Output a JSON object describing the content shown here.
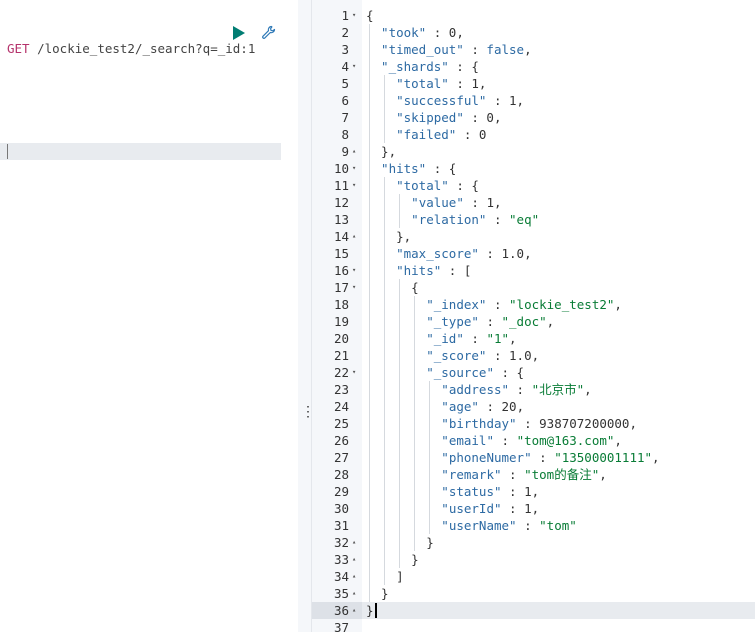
{
  "request": {
    "method": "GET",
    "path": "/lockie_test2/_search?q=_id:1",
    "run_icon": "play-icon",
    "settings_icon": "wrench-icon"
  },
  "divider": {
    "handle": "⋮"
  },
  "response": {
    "active_line": 36,
    "lines": [
      {
        "n": "1",
        "fold": "▾",
        "i": 0,
        "t": [
          [
            "p",
            "{"
          ]
        ]
      },
      {
        "n": "2",
        "fold": "",
        "i": 1,
        "t": [
          [
            "k",
            "\"took\""
          ],
          [
            "p",
            " : "
          ],
          [
            "n",
            "0"
          ],
          [
            "p",
            ","
          ]
        ]
      },
      {
        "n": "3",
        "fold": "",
        "i": 1,
        "t": [
          [
            "k",
            "\"timed_out\""
          ],
          [
            "p",
            " : "
          ],
          [
            "b",
            "false"
          ],
          [
            "p",
            ","
          ]
        ]
      },
      {
        "n": "4",
        "fold": "▾",
        "i": 1,
        "t": [
          [
            "k",
            "\"_shards\""
          ],
          [
            "p",
            " : {"
          ]
        ]
      },
      {
        "n": "5",
        "fold": "",
        "i": 2,
        "t": [
          [
            "k",
            "\"total\""
          ],
          [
            "p",
            " : "
          ],
          [
            "n",
            "1"
          ],
          [
            "p",
            ","
          ]
        ]
      },
      {
        "n": "6",
        "fold": "",
        "i": 2,
        "t": [
          [
            "k",
            "\"successful\""
          ],
          [
            "p",
            " : "
          ],
          [
            "n",
            "1"
          ],
          [
            "p",
            ","
          ]
        ]
      },
      {
        "n": "7",
        "fold": "",
        "i": 2,
        "t": [
          [
            "k",
            "\"skipped\""
          ],
          [
            "p",
            " : "
          ],
          [
            "n",
            "0"
          ],
          [
            "p",
            ","
          ]
        ]
      },
      {
        "n": "8",
        "fold": "",
        "i": 2,
        "t": [
          [
            "k",
            "\"failed\""
          ],
          [
            "p",
            " : "
          ],
          [
            "n",
            "0"
          ]
        ]
      },
      {
        "n": "9",
        "fold": "▴",
        "i": 1,
        "t": [
          [
            "p",
            "},"
          ]
        ]
      },
      {
        "n": "10",
        "fold": "▾",
        "i": 1,
        "t": [
          [
            "k",
            "\"hits\""
          ],
          [
            "p",
            " : {"
          ]
        ]
      },
      {
        "n": "11",
        "fold": "▾",
        "i": 2,
        "t": [
          [
            "k",
            "\"total\""
          ],
          [
            "p",
            " : {"
          ]
        ]
      },
      {
        "n": "12",
        "fold": "",
        "i": 3,
        "t": [
          [
            "k",
            "\"value\""
          ],
          [
            "p",
            " : "
          ],
          [
            "n",
            "1"
          ],
          [
            "p",
            ","
          ]
        ]
      },
      {
        "n": "13",
        "fold": "",
        "i": 3,
        "t": [
          [
            "k",
            "\"relation\""
          ],
          [
            "p",
            " : "
          ],
          [
            "s",
            "\"eq\""
          ]
        ]
      },
      {
        "n": "14",
        "fold": "▴",
        "i": 2,
        "t": [
          [
            "p",
            "},"
          ]
        ]
      },
      {
        "n": "15",
        "fold": "",
        "i": 2,
        "t": [
          [
            "k",
            "\"max_score\""
          ],
          [
            "p",
            " : "
          ],
          [
            "n",
            "1.0"
          ],
          [
            "p",
            ","
          ]
        ]
      },
      {
        "n": "16",
        "fold": "▾",
        "i": 2,
        "t": [
          [
            "k",
            "\"hits\""
          ],
          [
            "p",
            " : ["
          ]
        ]
      },
      {
        "n": "17",
        "fold": "▾",
        "i": 3,
        "t": [
          [
            "p",
            "{"
          ]
        ]
      },
      {
        "n": "18",
        "fold": "",
        "i": 4,
        "t": [
          [
            "k",
            "\"_index\""
          ],
          [
            "p",
            " : "
          ],
          [
            "s",
            "\"lockie_test2\""
          ],
          [
            "p",
            ","
          ]
        ]
      },
      {
        "n": "19",
        "fold": "",
        "i": 4,
        "t": [
          [
            "k",
            "\"_type\""
          ],
          [
            "p",
            " : "
          ],
          [
            "s",
            "\"_doc\""
          ],
          [
            "p",
            ","
          ]
        ]
      },
      {
        "n": "20",
        "fold": "",
        "i": 4,
        "t": [
          [
            "k",
            "\"_id\""
          ],
          [
            "p",
            " : "
          ],
          [
            "s",
            "\"1\""
          ],
          [
            "p",
            ","
          ]
        ]
      },
      {
        "n": "21",
        "fold": "",
        "i": 4,
        "t": [
          [
            "k",
            "\"_score\""
          ],
          [
            "p",
            " : "
          ],
          [
            "n",
            "1.0"
          ],
          [
            "p",
            ","
          ]
        ]
      },
      {
        "n": "22",
        "fold": "▾",
        "i": 4,
        "t": [
          [
            "k",
            "\"_source\""
          ],
          [
            "p",
            " : {"
          ]
        ]
      },
      {
        "n": "23",
        "fold": "",
        "i": 5,
        "t": [
          [
            "k",
            "\"address\""
          ],
          [
            "p",
            " : "
          ],
          [
            "s",
            "\"北京市\""
          ],
          [
            "p",
            ","
          ]
        ]
      },
      {
        "n": "24",
        "fold": "",
        "i": 5,
        "t": [
          [
            "k",
            "\"age\""
          ],
          [
            "p",
            " : "
          ],
          [
            "n",
            "20"
          ],
          [
            "p",
            ","
          ]
        ]
      },
      {
        "n": "25",
        "fold": "",
        "i": 5,
        "t": [
          [
            "k",
            "\"birthday\""
          ],
          [
            "p",
            " : "
          ],
          [
            "n",
            "938707200000"
          ],
          [
            "p",
            ","
          ]
        ]
      },
      {
        "n": "26",
        "fold": "",
        "i": 5,
        "t": [
          [
            "k",
            "\"email\""
          ],
          [
            "p",
            " : "
          ],
          [
            "s",
            "\"tom@163.com\""
          ],
          [
            "p",
            ","
          ]
        ]
      },
      {
        "n": "27",
        "fold": "",
        "i": 5,
        "t": [
          [
            "k",
            "\"phoneNumer\""
          ],
          [
            "p",
            " : "
          ],
          [
            "s",
            "\"13500001111\""
          ],
          [
            "p",
            ","
          ]
        ]
      },
      {
        "n": "28",
        "fold": "",
        "i": 5,
        "t": [
          [
            "k",
            "\"remark\""
          ],
          [
            "p",
            " : "
          ],
          [
            "s",
            "\"tom的备注\""
          ],
          [
            "p",
            ","
          ]
        ]
      },
      {
        "n": "29",
        "fold": "",
        "i": 5,
        "t": [
          [
            "k",
            "\"status\""
          ],
          [
            "p",
            " : "
          ],
          [
            "n",
            "1"
          ],
          [
            "p",
            ","
          ]
        ]
      },
      {
        "n": "30",
        "fold": "",
        "i": 5,
        "t": [
          [
            "k",
            "\"userId\""
          ],
          [
            "p",
            " : "
          ],
          [
            "n",
            "1"
          ],
          [
            "p",
            ","
          ]
        ]
      },
      {
        "n": "31",
        "fold": "",
        "i": 5,
        "t": [
          [
            "k",
            "\"userName\""
          ],
          [
            "p",
            " : "
          ],
          [
            "s",
            "\"tom\""
          ]
        ]
      },
      {
        "n": "32",
        "fold": "▴",
        "i": 4,
        "t": [
          [
            "p",
            "}"
          ]
        ]
      },
      {
        "n": "33",
        "fold": "▴",
        "i": 3,
        "t": [
          [
            "p",
            "}"
          ]
        ]
      },
      {
        "n": "34",
        "fold": "▴",
        "i": 2,
        "t": [
          [
            "p",
            "]"
          ]
        ]
      },
      {
        "n": "35",
        "fold": "▴",
        "i": 1,
        "t": [
          [
            "p",
            "}"
          ]
        ]
      },
      {
        "n": "36",
        "fold": "▴",
        "i": 0,
        "t": [
          [
            "p",
            "}"
          ]
        ]
      },
      {
        "n": "37",
        "fold": "",
        "i": 0,
        "t": []
      }
    ]
  }
}
